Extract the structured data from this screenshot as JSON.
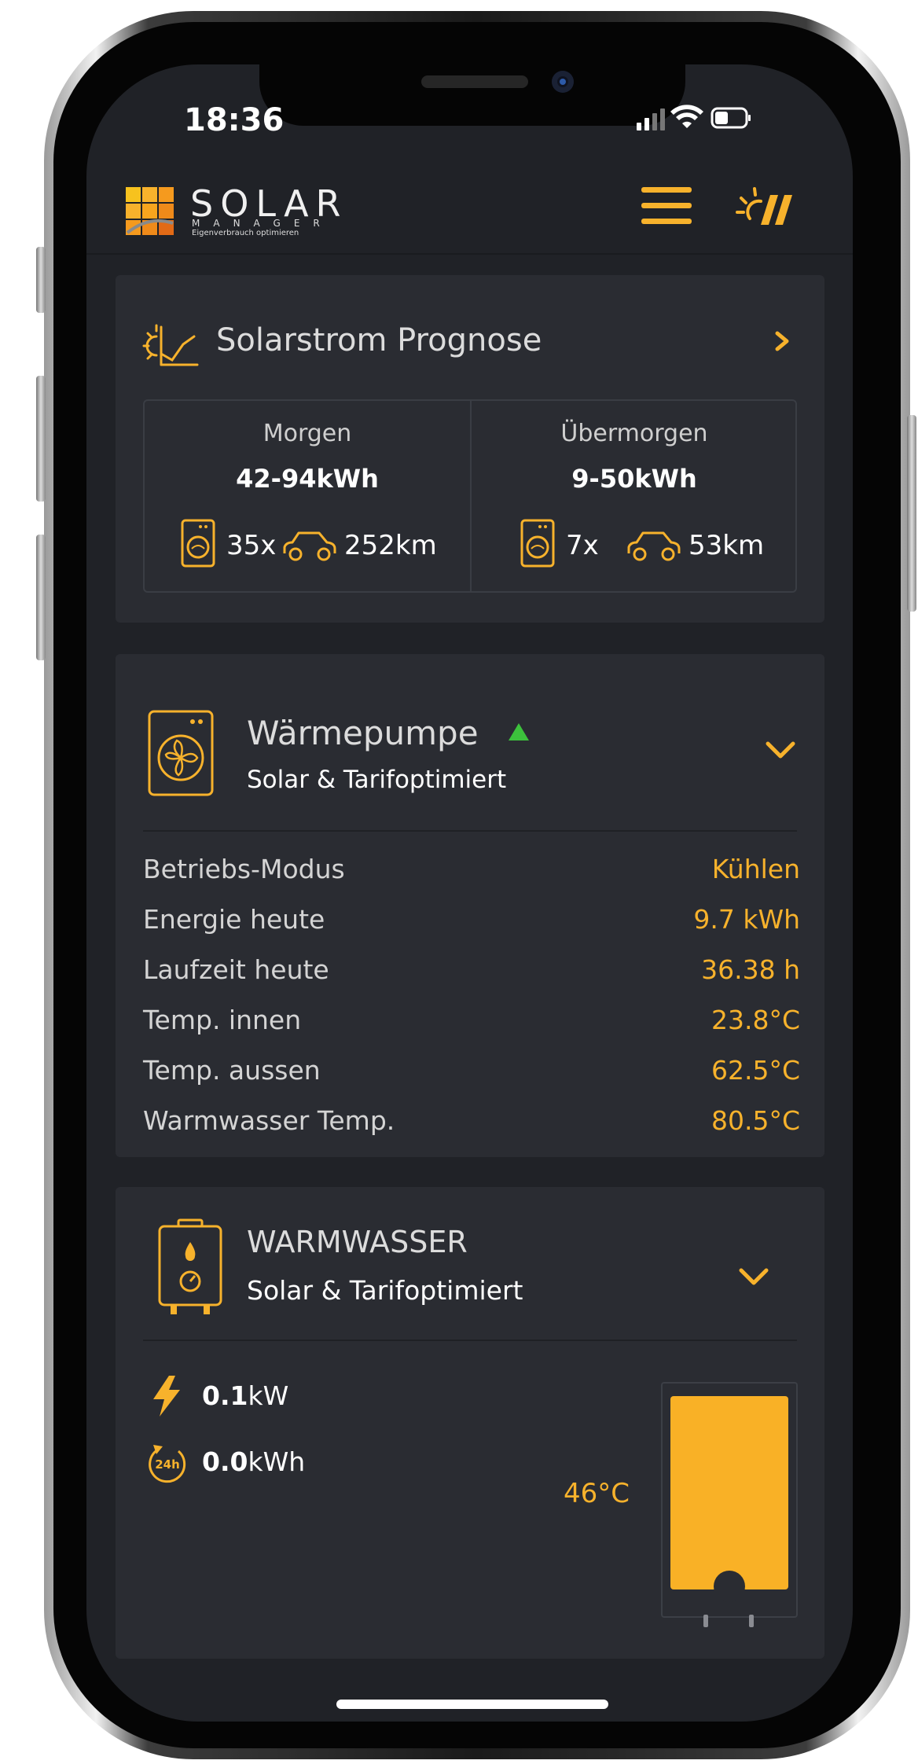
{
  "status_bar": {
    "time": "18:36"
  },
  "header": {
    "logo": {
      "word": "SOLAR",
      "sub": "MANAGER",
      "tagline": "Eigenverbrauch optimieren"
    },
    "menu_icon": "hamburger-menu-icon",
    "brand_icon": "sun-stripes-icon"
  },
  "forecast_card": {
    "title": "Solarstrom Prognose",
    "days": [
      {
        "label": "Morgen",
        "range": "42-94kWh",
        "washes": "35x",
        "distance": "252km"
      },
      {
        "label": "Übermorgen",
        "range": "9-50kWh",
        "washes": "7x",
        "distance": "53km"
      }
    ]
  },
  "heatpump_card": {
    "title": "Wärmepumpe",
    "subtitle": "Solar & Tarifoptimiert",
    "status_icon": "green-triangle-up-icon",
    "rows": [
      {
        "label": "Betriebs-Modus",
        "value": "Kühlen"
      },
      {
        "label": "Energie heute",
        "value": "9.7 kWh"
      },
      {
        "label": "Laufzeit heute",
        "value": "36.38 h"
      },
      {
        "label": "Temp. innen",
        "value": "23.8°C"
      },
      {
        "label": "Temp. aussen",
        "value": "62.5°C"
      },
      {
        "label": "Warmwasser Temp.",
        "value": "80.5°C"
      }
    ]
  },
  "water_card": {
    "title": "WARMWASSER",
    "subtitle": "Solar & Tarifoptimiert",
    "power_value": "0.1",
    "power_unit": "kW",
    "energy_value": "0.0",
    "energy_unit": "kWh",
    "energy_icon_label": "24h",
    "tank_temp": "46°C",
    "tank_fill_fraction": 1.0
  },
  "colors": {
    "accent": "#f7b22c",
    "background": "#202227",
    "card": "#2a2c32",
    "status_green": "#3cc23c"
  }
}
